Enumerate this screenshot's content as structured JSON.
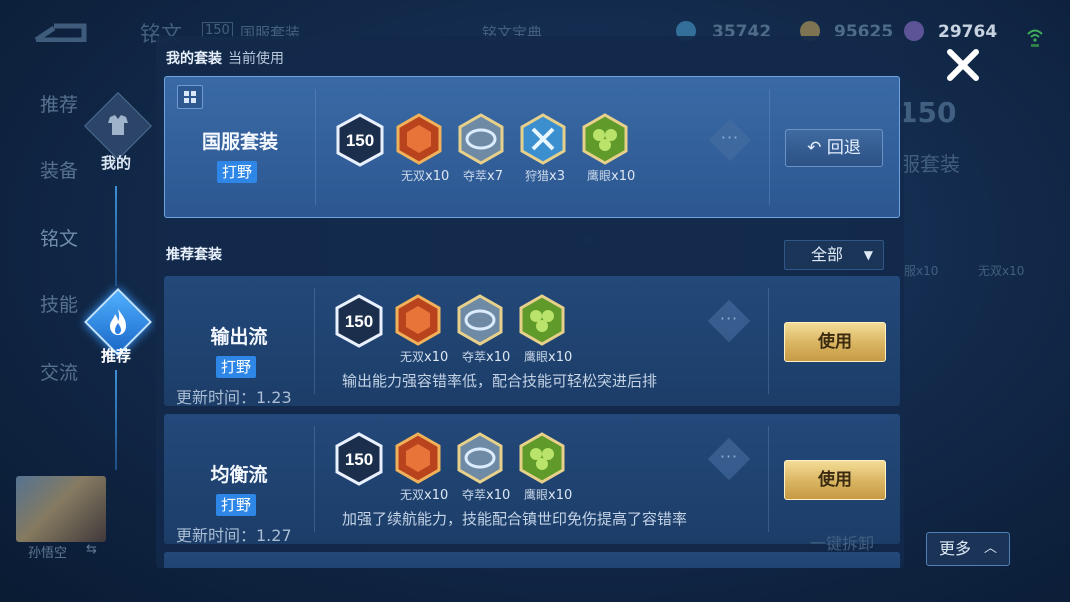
{
  "header": {
    "back_icon": "back-arrow-icon",
    "page_title": "铭文",
    "level": "150",
    "set_name": "国服套装",
    "codex_label": "铭文宝典",
    "currency": [
      {
        "icon": "diamond-icon",
        "value": "35742",
        "color": "#4fa7d8"
      },
      {
        "icon": "gold-coin-icon",
        "value": "95625",
        "color": "#d7b05a"
      },
      {
        "icon": "crystal-icon",
        "value": "29764",
        "color": "#9a7ad8"
      }
    ]
  },
  "left_nav": {
    "items": [
      "推荐",
      "装备",
      "铭文",
      "技能",
      "交流"
    ],
    "rail": [
      {
        "label": "我的",
        "icon": "armor-icon"
      },
      {
        "label": "推荐",
        "icon": "flame-icon"
      }
    ],
    "hero_name": "孙悟空",
    "swap_icon": "swap-icon"
  },
  "my_sets": {
    "title": "我的套装",
    "subtitle": "当前使用",
    "current": {
      "name": "国服套装",
      "role": "打野",
      "level": "150",
      "runes": [
        {
          "name": "无双",
          "count": "x10",
          "color": "#d8552a"
        },
        {
          "name": "夺萃",
          "count": "x7",
          "color": "#9fb8cf"
        },
        {
          "name": "狩猎",
          "count": "x3",
          "color": "#4fb3e6"
        },
        {
          "name": "鹰眼",
          "count": "x10",
          "color": "#7fb23a"
        }
      ],
      "back_label": "回退"
    }
  },
  "recommended": {
    "title": "推荐套装",
    "filter_label": "全部",
    "sets": [
      {
        "name": "输出流",
        "role": "打野",
        "level": "150",
        "runes": [
          {
            "name": "无双",
            "count": "x10",
            "color": "#d8552a"
          },
          {
            "name": "夺萃",
            "count": "x10",
            "color": "#9fb8cf"
          },
          {
            "name": "鹰眼",
            "count": "x10",
            "color": "#7fb23a"
          }
        ],
        "description": "输出能力强容错率低，配合技能可轻松突进后排",
        "update_time": "更新时间：1.23",
        "use_label": "使用"
      },
      {
        "name": "均衡流",
        "role": "打野",
        "level": "150",
        "runes": [
          {
            "name": "无双",
            "count": "x10",
            "color": "#d8552a"
          },
          {
            "name": "夺萃",
            "count": "x10",
            "color": "#9fb8cf"
          },
          {
            "name": "鹰眼",
            "count": "x10",
            "color": "#7fb23a"
          }
        ],
        "description": "加强了续航能力，技能配合镇世印免伤提高了容错率",
        "update_time": "更新时间：1.27",
        "use_label": "使用"
      }
    ]
  },
  "background": {
    "right_level": "150",
    "right_set_name": "服套装",
    "right_caps": [
      "服x10",
      "无双x10"
    ],
    "bottom_action": "一键拆卸"
  },
  "more_label": "更多"
}
